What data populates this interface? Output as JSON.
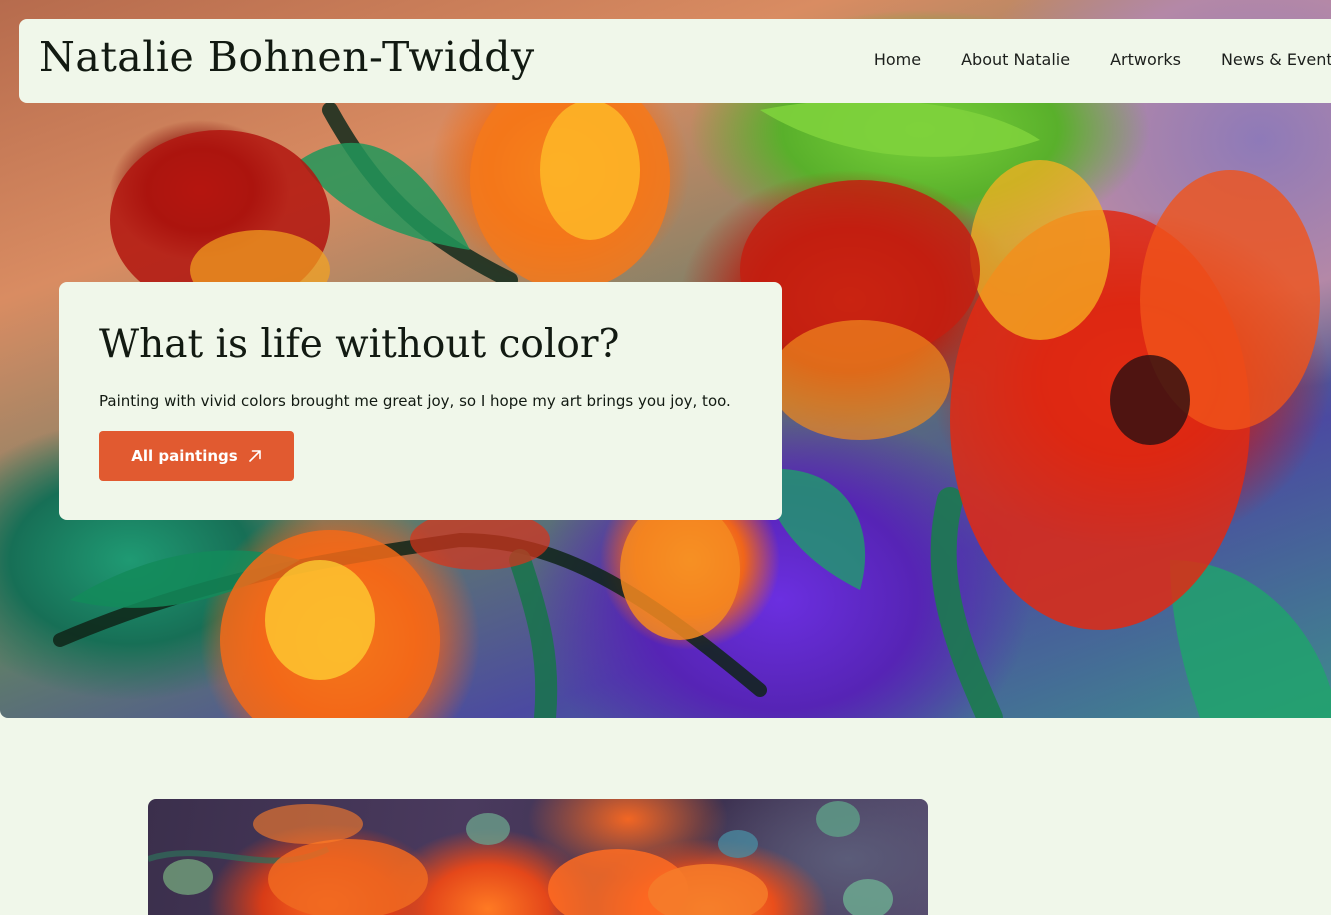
{
  "header": {
    "site_title": "Natalie Bohnen-Twiddy",
    "nav": [
      {
        "label": "Home"
      },
      {
        "label": "About Natalie"
      },
      {
        "label": "Artworks"
      },
      {
        "label": "News & Events"
      }
    ]
  },
  "hero": {
    "heading": "What is life without color?",
    "text": "Painting with vivid colors brought me great joy, so I hope my art brings you joy, too.",
    "button_label": "All paintings",
    "button_icon": "arrow-up-right-icon"
  },
  "colors": {
    "background": "#f0f7ea",
    "accent": "#e15a30",
    "text": "#121a12"
  }
}
